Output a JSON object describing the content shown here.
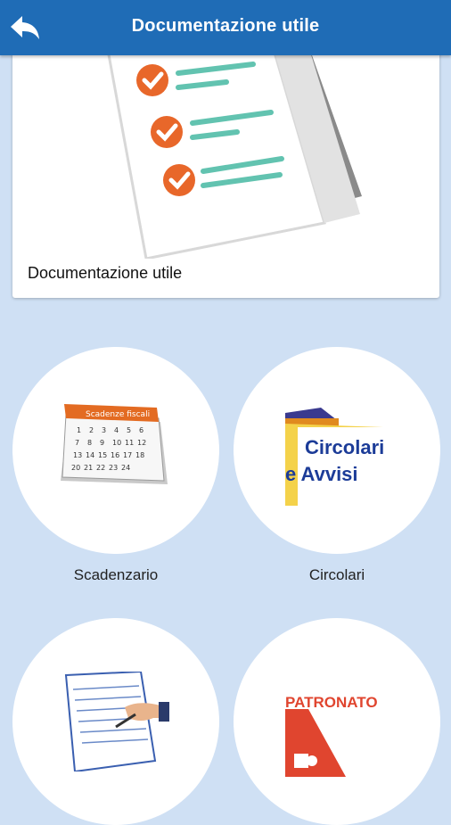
{
  "appbar": {
    "title": "Documentazione utile",
    "back_icon": "back-arrow-icon"
  },
  "hero_card": {
    "label": "Documentazione utile",
    "image": "checklist-documents-illustration"
  },
  "tiles": [
    {
      "label": "Scadenzario",
      "image": "calendar-icon",
      "caption": "Scadenze fiscali"
    },
    {
      "label": "Circolari",
      "image": "folder-circolari-icon",
      "caption_lines": [
        "Circolari",
        "e Avvisi"
      ]
    },
    {
      "label": "",
      "image": "signing-document-icon",
      "caption": ""
    },
    {
      "label": "",
      "image": "patronato-icon",
      "caption": "PATRONATO"
    }
  ],
  "colors": {
    "appbar": "#1f6cb6",
    "background": "#cfe0f4",
    "check_orange": "#e8672a",
    "checklist_line": "#62c3b0",
    "patronato_red": "#e0452f"
  }
}
